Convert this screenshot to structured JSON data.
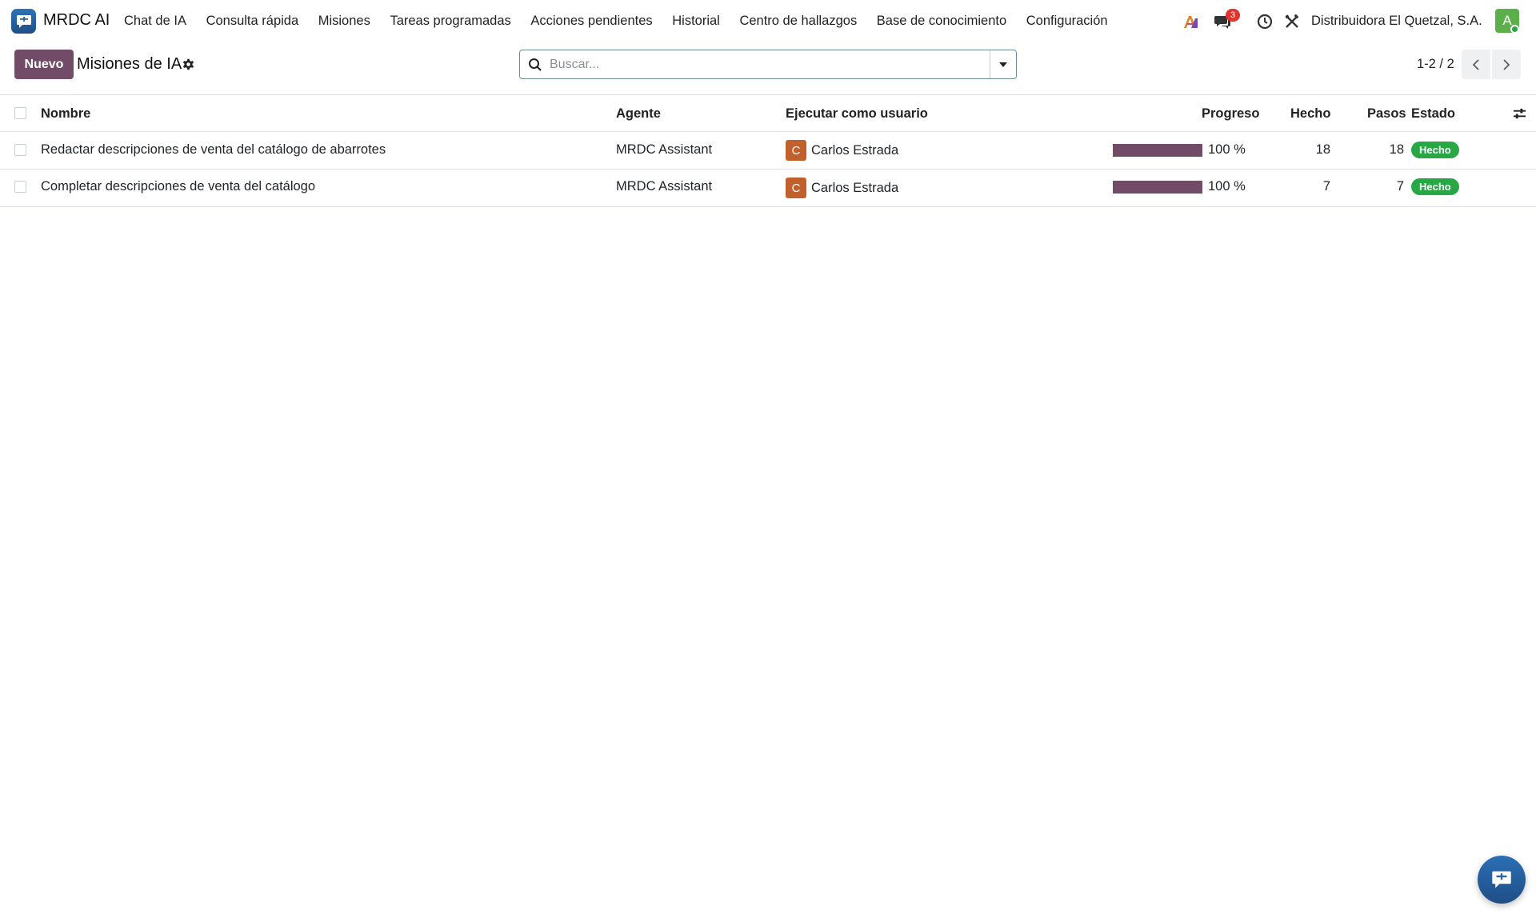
{
  "app": {
    "name": "MRDC AI"
  },
  "menu": {
    "items": [
      {
        "label": "Chat de IA"
      },
      {
        "label": "Consulta rápida"
      },
      {
        "label": "Misiones"
      },
      {
        "label": "Tareas programadas"
      },
      {
        "label": "Acciones pendientes"
      },
      {
        "label": "Historial"
      },
      {
        "label": "Centro de hallazgos"
      },
      {
        "label": "Base de conocimiento"
      },
      {
        "label": "Configuración"
      }
    ]
  },
  "systray": {
    "messages_count": "3",
    "company": "Distribuidora El Quetzal, S.A.",
    "avatar_letter": "A"
  },
  "control_panel": {
    "new_label": "Nuevo",
    "title": "Misiones de IA",
    "search_placeholder": "Buscar...",
    "pager": "1-2 / 2"
  },
  "list": {
    "columns": {
      "name": "Nombre",
      "agent": "Agente",
      "run_as": "Ejecutar como usuario",
      "progress": "Progreso",
      "done": "Hecho",
      "steps": "Pasos",
      "state": "Estado"
    },
    "rows": [
      {
        "name": "Redactar descripciones de venta del catálogo de abarrotes",
        "agent": "MRDC Assistant",
        "user_initial": "C",
        "user": "Carlos Estrada",
        "progress": 1.0,
        "progress_label": "100 %",
        "done": "18",
        "steps": "18",
        "state": "Hecho"
      },
      {
        "name": "Completar descripciones de venta del catálogo",
        "agent": "MRDC Assistant",
        "user_initial": "C",
        "user": "Carlos Estrada",
        "progress": 1.0,
        "progress_label": "100 %",
        "done": "7",
        "steps": "7",
        "state": "Hecho"
      }
    ]
  },
  "colors": {
    "brand": "#714b67",
    "success": "#28a745",
    "user_avatar": "#c1602c",
    "user_avatar_main": "#5cb04b",
    "badge": "#e2342d"
  },
  "icons": {
    "logo": "chat-bubble-icon",
    "ai": "ai-spark-icon",
    "messages": "chat-icon",
    "activity": "clock-icon",
    "tools": "tools-icon",
    "settings": "gear-icon",
    "search": "search-icon",
    "dropdown": "caret-down-icon",
    "prev": "chevron-left-icon",
    "next": "chevron-right-icon",
    "optional_columns": "sliders-icon",
    "fab": "chat-bubble-icon"
  }
}
